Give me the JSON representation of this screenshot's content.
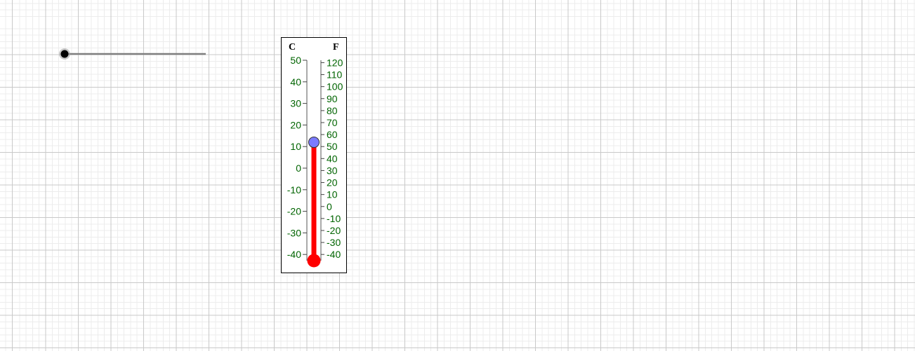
{
  "slider": {
    "value_fraction": 0.0
  },
  "thermometer": {
    "celsius_label": "C",
    "fahrenheit_label": "F",
    "celsius_ticks": [
      "50",
      "40",
      "30",
      "20",
      "10",
      "0",
      "-10",
      "-20",
      "-30",
      "-40"
    ],
    "fahrenheit_ticks": [
      "120",
      "110",
      "100",
      "90",
      "80",
      "70",
      "60",
      "50",
      "40",
      "30",
      "20",
      "10",
      "0",
      "-10",
      "-20",
      "-30",
      "-40"
    ],
    "current_celsius": 12,
    "tick_color": "#006400",
    "mercury_color": "#ff0000",
    "handle_color": "#7b7bff"
  }
}
